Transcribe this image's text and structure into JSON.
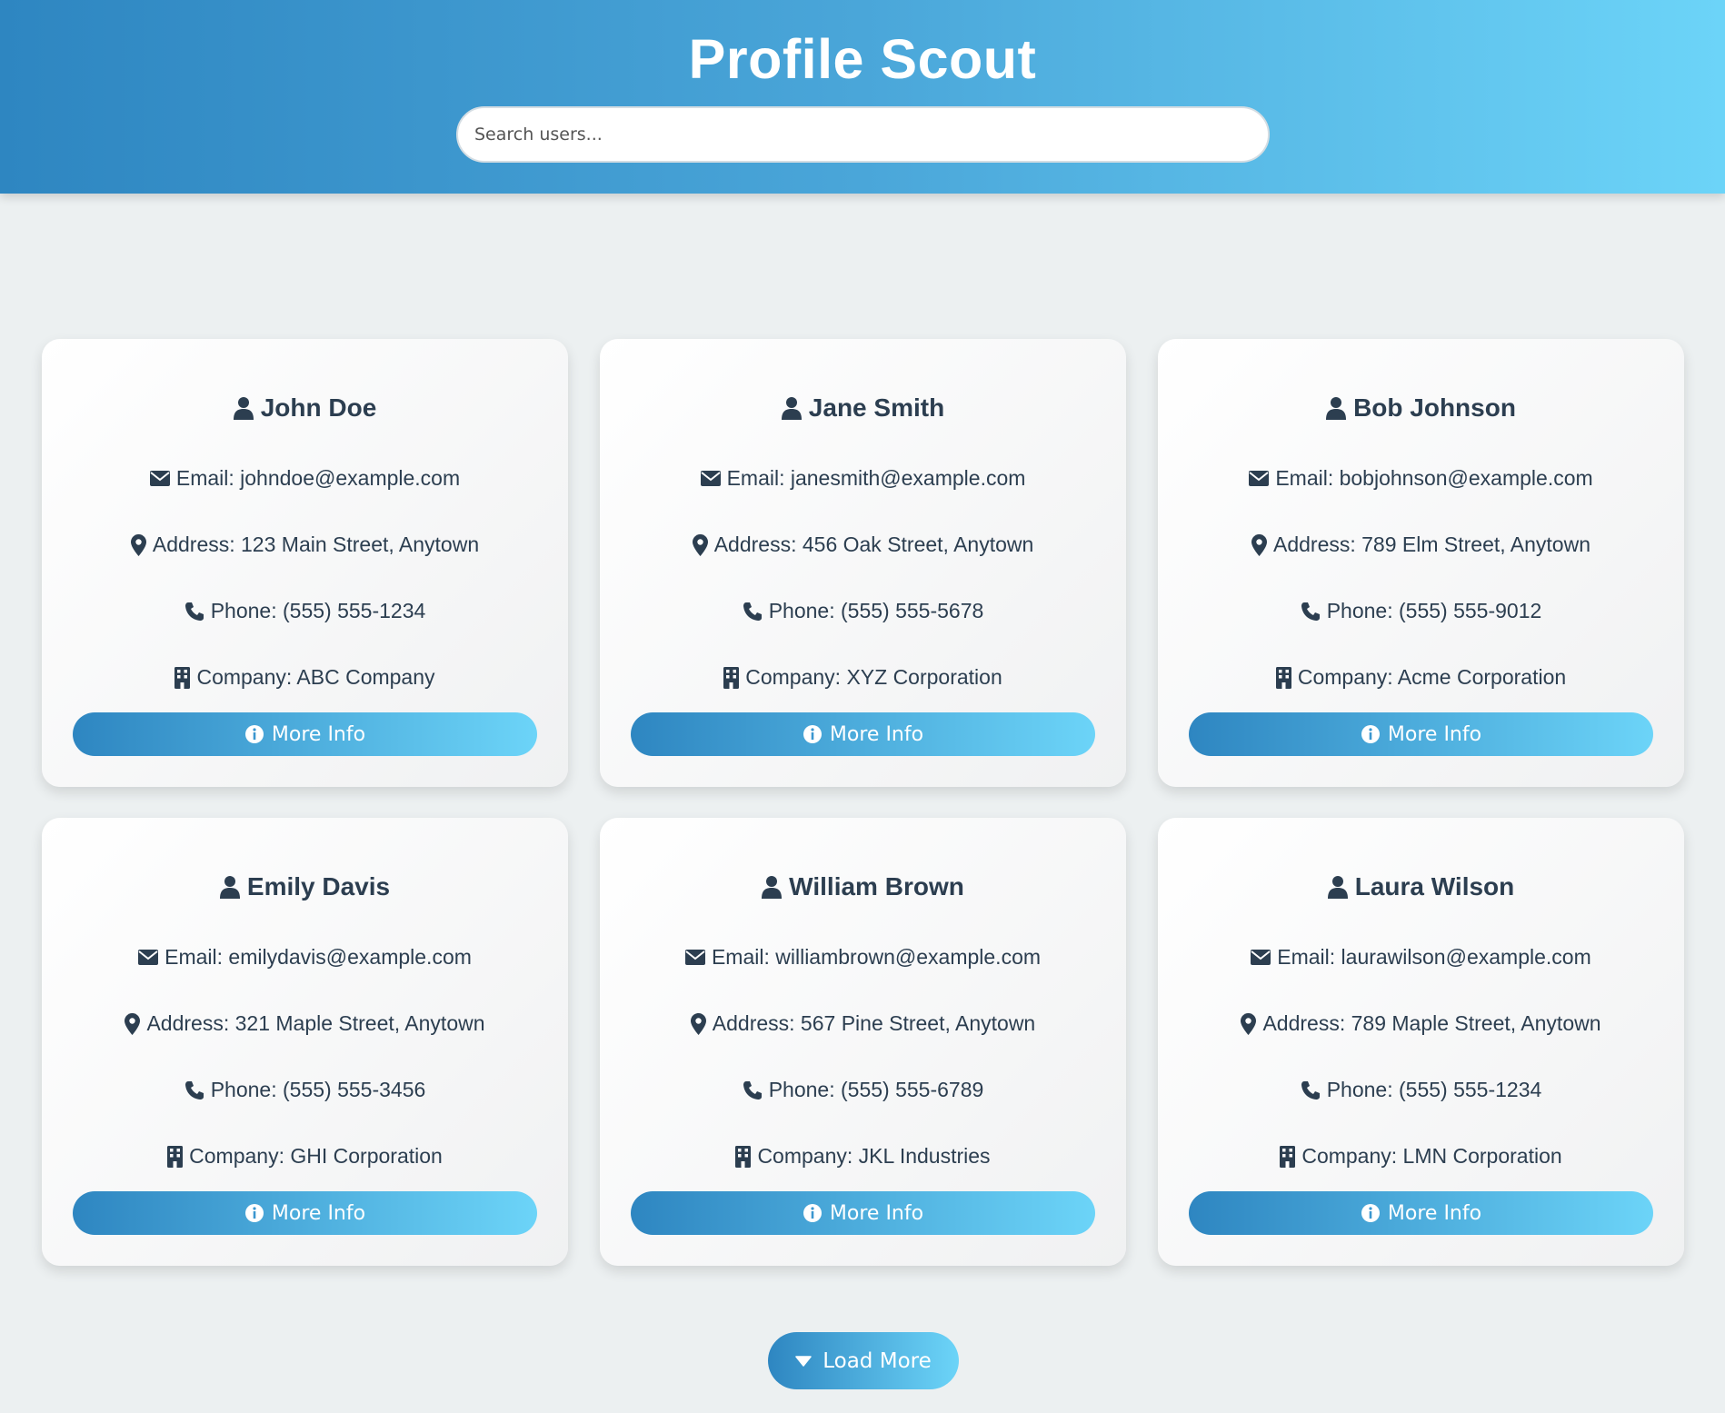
{
  "header": {
    "title": "Profile Scout",
    "search_placeholder": "Search users..."
  },
  "users": [
    {
      "name": "John Doe",
      "email": "Email: johndoe@example.com",
      "address": "Address: 123 Main Street, Anytown",
      "phone": "Phone: (555) 555-1234",
      "company": "Company: ABC Company"
    },
    {
      "name": "Jane Smith",
      "email": "Email: janesmith@example.com",
      "address": "Address: 456 Oak Street, Anytown",
      "phone": "Phone: (555) 555-5678",
      "company": "Company: XYZ Corporation"
    },
    {
      "name": "Bob Johnson",
      "email": "Email: bobjohnson@example.com",
      "address": "Address: 789 Elm Street, Anytown",
      "phone": "Phone: (555) 555-9012",
      "company": "Company: Acme Corporation"
    },
    {
      "name": "Emily Davis",
      "email": "Email: emilydavis@example.com",
      "address": "Address: 321 Maple Street, Anytown",
      "phone": "Phone: (555) 555-3456",
      "company": "Company: GHI Corporation"
    },
    {
      "name": "William Brown",
      "email": "Email: williambrown@example.com",
      "address": "Address: 567 Pine Street, Anytown",
      "phone": "Phone: (555) 555-6789",
      "company": "Company: JKL Industries"
    },
    {
      "name": "Laura Wilson",
      "email": "Email: laurawilson@example.com",
      "address": "Address: 789 Maple Street, Anytown",
      "phone": "Phone: (555) 555-1234",
      "company": "Company: LMN Corporation"
    }
  ],
  "buttons": {
    "more_info": "More Info",
    "load_more": "Load More"
  },
  "icons": {
    "name": "user-icon",
    "email": "envelope-icon",
    "address": "map-pin-icon",
    "phone": "phone-icon",
    "company": "building-icon",
    "more_info": "info-circle-icon",
    "load_more": "caret-down-icon"
  },
  "colors": {
    "header_gradient_start": "#2e86c1",
    "header_gradient_end": "#6cd4f8",
    "text": "#2c3e50",
    "background": "#ecf0f1"
  }
}
